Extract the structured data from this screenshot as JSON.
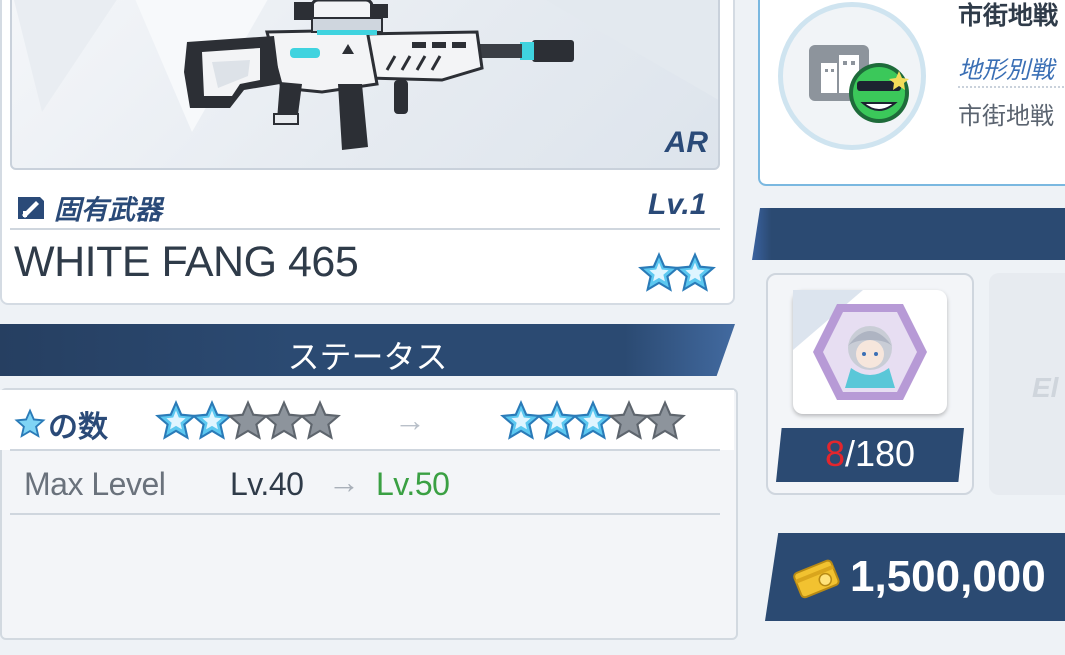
{
  "weapon": {
    "type": "AR",
    "subtitle": "固有武器",
    "level": "Lv.1",
    "name": "WHITE FANG 465",
    "rarity_stars": 2
  },
  "status": {
    "header": "ステータス",
    "star_row": {
      "label": "の数",
      "from_filled": 2,
      "to_filled": 3,
      "total": 5,
      "arrow": "→"
    },
    "max_level": {
      "label": "Max Level",
      "from": "Lv.40",
      "arrow": "→",
      "to": "Lv.50"
    }
  },
  "terrain": {
    "title": "市街地戦",
    "subtitle": "地形別戦",
    "description": "市街地戦"
  },
  "material": {
    "have": "8",
    "need": "/180",
    "second_label": "El"
  },
  "credits": {
    "amount": "1,500,000"
  },
  "colors": {
    "navy": "#2b4a72",
    "star_blue": "#5cc8f0",
    "star_grey": "#8d949c",
    "green": "#3aa043",
    "red": "#e3262d"
  }
}
